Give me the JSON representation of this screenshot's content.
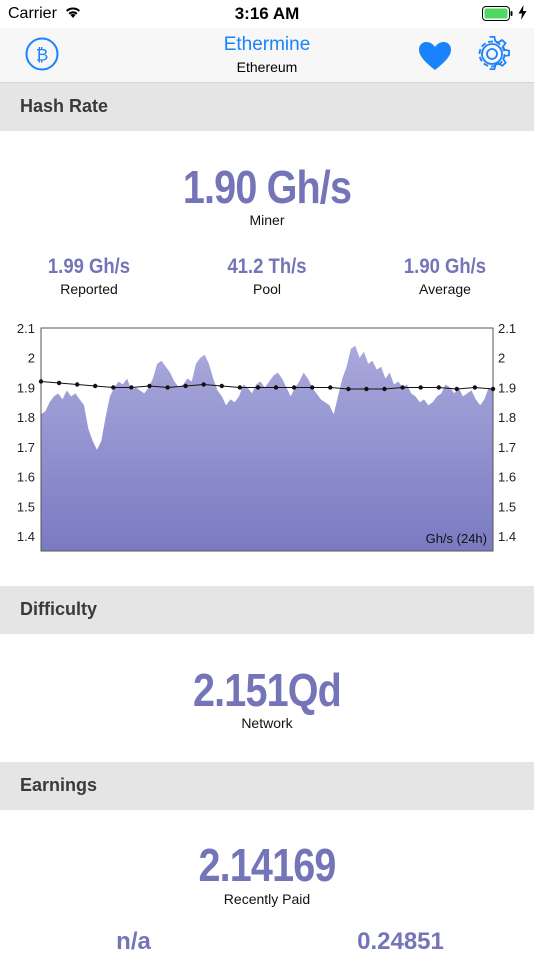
{
  "status_bar": {
    "carrier": "Carrier",
    "time": "3:16 AM"
  },
  "nav": {
    "title": "Ethermine",
    "subtitle": "Ethereum",
    "accent": "#1a82fb"
  },
  "hash_rate": {
    "header": "Hash Rate",
    "miner_value": "1.90 Gh/s",
    "miner_label": "Miner",
    "reported_value": "1.99 Gh/s",
    "reported_label": "Reported",
    "pool_value": "41.2 Th/s",
    "pool_label": "Pool",
    "average_value": "1.90 Gh/s",
    "average_label": "Average"
  },
  "chart_data": {
    "type": "area",
    "ylim": [
      1.35,
      2.1
    ],
    "yticks": [
      "2.1",
      "2",
      "1.9",
      "1.8",
      "1.7",
      "1.6",
      "1.5",
      "1.4"
    ],
    "unit_label": "Gh/s (24h)",
    "fill_color": "#7a7ac2",
    "series": [
      {
        "values": [
          1.81,
          1.82,
          1.85,
          1.87,
          1.88,
          1.86,
          1.89,
          1.87,
          1.88,
          1.86,
          1.84,
          1.76,
          1.72,
          1.69,
          1.72,
          1.8,
          1.87,
          1.9,
          1.92,
          1.91,
          1.93,
          1.89,
          1.9,
          1.89,
          1.88,
          1.9,
          1.93,
          1.98,
          1.99,
          1.97,
          1.95,
          1.92,
          1.9,
          1.91,
          1.93,
          1.92,
          1.98,
          2.0,
          2.01,
          1.98,
          1.93,
          1.89,
          1.87,
          1.84,
          1.86,
          1.85,
          1.87,
          1.91,
          1.9,
          1.88,
          1.91,
          1.92,
          1.9,
          1.92,
          1.94,
          1.95,
          1.93,
          1.9,
          1.87,
          1.9,
          1.92,
          1.95,
          1.93,
          1.9,
          1.88,
          1.86,
          1.85,
          1.84,
          1.81,
          1.87,
          1.93,
          1.97,
          2.03,
          2.04,
          2.0,
          2.02,
          1.98,
          1.99,
          1.96,
          1.97,
          1.93,
          1.95,
          1.91,
          1.92,
          1.9,
          1.91,
          1.88,
          1.87,
          1.85,
          1.86,
          1.84,
          1.85,
          1.87,
          1.88,
          1.91,
          1.9,
          1.88,
          1.9,
          1.87,
          1.88,
          1.89,
          1.86,
          1.84,
          1.86,
          1.9,
          1.89
        ]
      },
      {
        "values": [
          1.92,
          1.915,
          1.91,
          1.905,
          1.9,
          1.9,
          1.905,
          1.9,
          1.905,
          1.91,
          1.905,
          1.9,
          1.9,
          1.9,
          1.9,
          1.9,
          1.9,
          1.895,
          1.895,
          1.895,
          1.9,
          1.9,
          1.9,
          1.895,
          1.9,
          1.895
        ]
      }
    ]
  },
  "difficulty": {
    "header": "Difficulty",
    "value": "2.151Qd",
    "label": "Network"
  },
  "earnings": {
    "header": "Earnings",
    "value": "2.14169",
    "label": "Recently Paid",
    "left_value": "n/a",
    "right_value": "0.24851"
  }
}
